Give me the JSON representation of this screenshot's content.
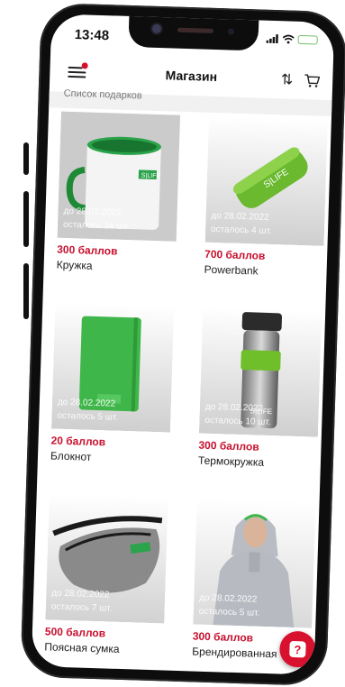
{
  "status": {
    "time": "13:48"
  },
  "header": {
    "title": "Магазин"
  },
  "subheader": {
    "text": "Список подарков"
  },
  "colors": {
    "accent": "#c8102e",
    "brand_green": "#5cbf3a"
  },
  "products": [
    {
      "price": "300 баллов",
      "name": "Кружка",
      "expires": "до 28.02.2022",
      "left": "осталось 14 шт."
    },
    {
      "price": "700 баллов",
      "name": "Powerbank",
      "expires": "до 28.02.2022",
      "left": "осталось 4 шт."
    },
    {
      "price": "20 баллов",
      "name": "Блокнот",
      "expires": "до 28.02.2022",
      "left": "осталось 5 шт."
    },
    {
      "price": "300 баллов",
      "name": "Термокружка",
      "expires": "до 28.02.2022",
      "left": "осталось 10 шт."
    },
    {
      "price": "500 баллов",
      "name": "Поясная сумка",
      "expires": "до 28.02.2022",
      "left": "осталось 7 шт."
    },
    {
      "price": "300 баллов",
      "name": "Брендированная",
      "expires": "до 28.02.2022",
      "left": "осталось 5 шт."
    }
  ],
  "help_button": {
    "label": "?"
  }
}
